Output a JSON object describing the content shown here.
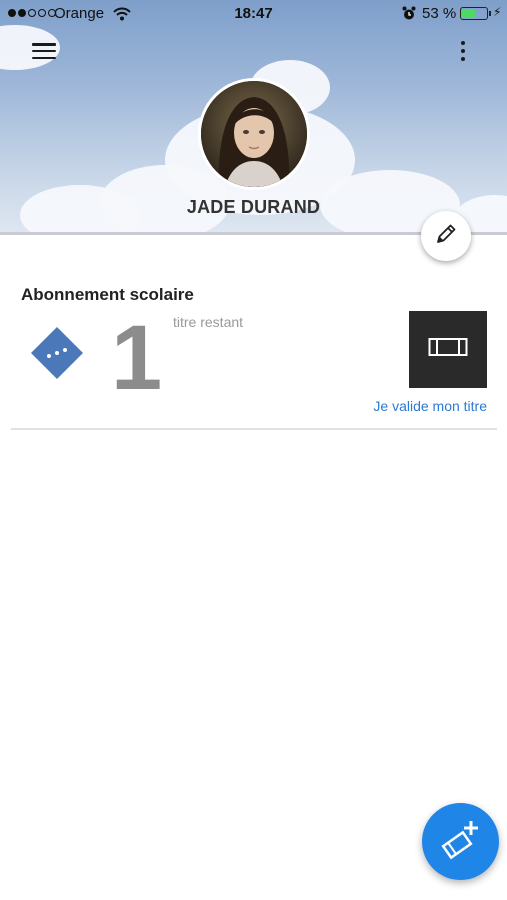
{
  "status_bar": {
    "carrier": "Orange",
    "time": "18:47",
    "battery_percent": "53 %",
    "battery_level": 0.53,
    "signal_bars_filled": 2,
    "signal_bars_total": 5
  },
  "header": {
    "menu_icon": "hamburger-menu-icon",
    "more_icon": "more-vertical-icon",
    "profile_name": "JADE DURAND",
    "edit_icon": "pencil-icon"
  },
  "subscription": {
    "title": "Abonnement scolaire",
    "ticket_icon": "ticket-icon",
    "remaining_count": "1",
    "remaining_label": "titre restant",
    "validate_icon": "validation-terminal-icon",
    "validate_link": "Je valide mon titre"
  },
  "fab": {
    "icon": "add-ticket-icon"
  },
  "colors": {
    "accent_blue": "#1f86e8",
    "link_blue": "#2a7ad6",
    "ticket_blue": "#4a78b8",
    "tile_dark": "#2a2a2a",
    "battery_green": "#4cd964"
  }
}
